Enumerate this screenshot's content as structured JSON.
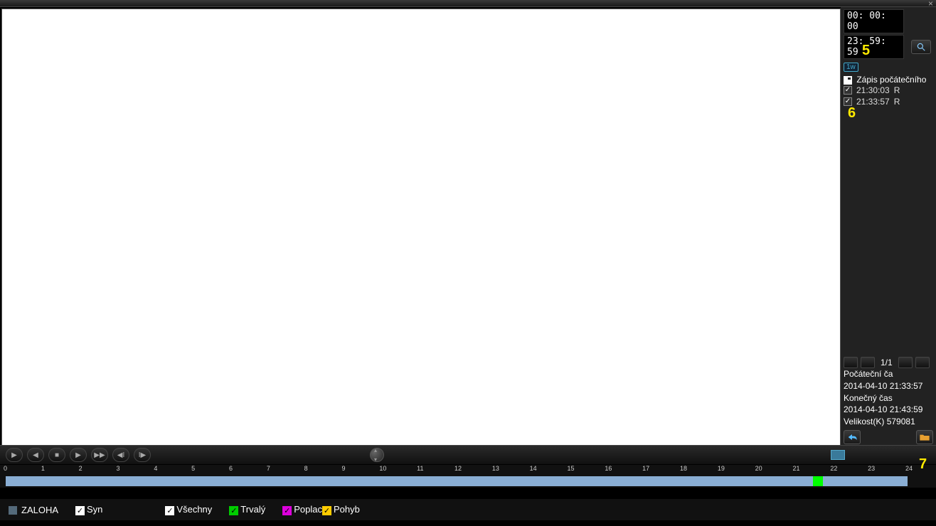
{
  "titlebar": {
    "close": "×"
  },
  "side": {
    "time_start": "00: 00: 00",
    "time_end": "23: 59: 59",
    "badge": "1w",
    "list_header": "Zápis počátečního",
    "recordings": [
      {
        "time": "21:30:03",
        "type": "R"
      },
      {
        "time": "21:33:57",
        "type": "R"
      }
    ],
    "page": "1/1",
    "info": {
      "start_lbl": "Počáteční ča",
      "start_val": "2014-04-10 21:33:57",
      "end_lbl": "Konečný čas",
      "end_val": "2014-04-10 21:43:59",
      "size_lbl": "Velikost(K)",
      "size_val": "579081"
    }
  },
  "callouts": {
    "c5": "5",
    "c6": "6",
    "c7": "7"
  },
  "timeline": {
    "hours": [
      "0",
      "1",
      "2",
      "3",
      "4",
      "5",
      "6",
      "7",
      "8",
      "9",
      "10",
      "11",
      "12",
      "13",
      "14",
      "15",
      "16",
      "17",
      "18",
      "19",
      "20",
      "21",
      "22",
      "23",
      "24"
    ]
  },
  "legend": {
    "backup": "ZALOHA",
    "syn": "Syn",
    "all": "Všechny",
    "cont": "Trvalý",
    "alarm": "Poplac",
    "motion": "Pohyb"
  }
}
